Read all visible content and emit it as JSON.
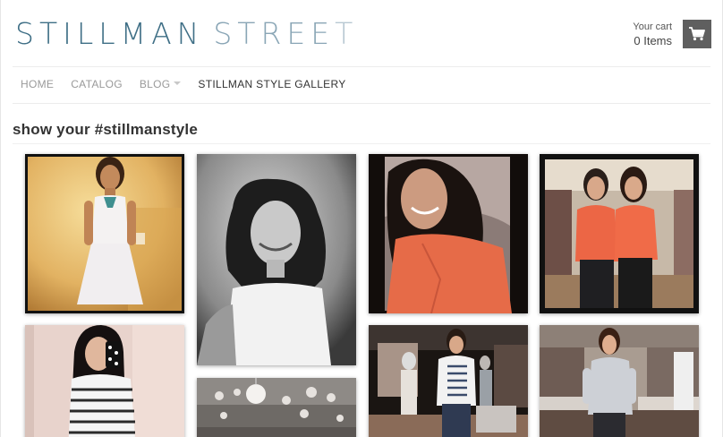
{
  "header": {
    "logo_word1": "STILLMAN",
    "logo_word2": "STREE",
    "logo_word2_last": "T",
    "cart_label": "Your cart",
    "cart_count": "0 Items",
    "cart_icon": "shopping-cart-icon"
  },
  "nav": {
    "items": [
      {
        "label": "HOME",
        "active": false
      },
      {
        "label": "CATALOG",
        "active": false
      },
      {
        "label": "BLOG",
        "active": false,
        "has_dropdown": true
      },
      {
        "label": "STILLMAN STYLE GALLERY",
        "active": true
      }
    ]
  },
  "main": {
    "title": "show your #stillmanstyle"
  },
  "gallery": {
    "photos": [
      {
        "name": "photo-white-dress"
      },
      {
        "name": "photo-black-white-portrait"
      },
      {
        "name": "photo-coral-blouse-selfie"
      },
      {
        "name": "photo-two-women-coral"
      },
      {
        "name": "photo-striped-mirror-selfie"
      },
      {
        "name": "photo-chandelier-store"
      },
      {
        "name": "photo-boutique-striped-top"
      },
      {
        "name": "photo-boutique-grey-top"
      }
    ]
  },
  "colors": {
    "logo_dark": "#3f6f86",
    "logo_light": "#8aa6b6",
    "cart_button": "#5f5f5f"
  }
}
